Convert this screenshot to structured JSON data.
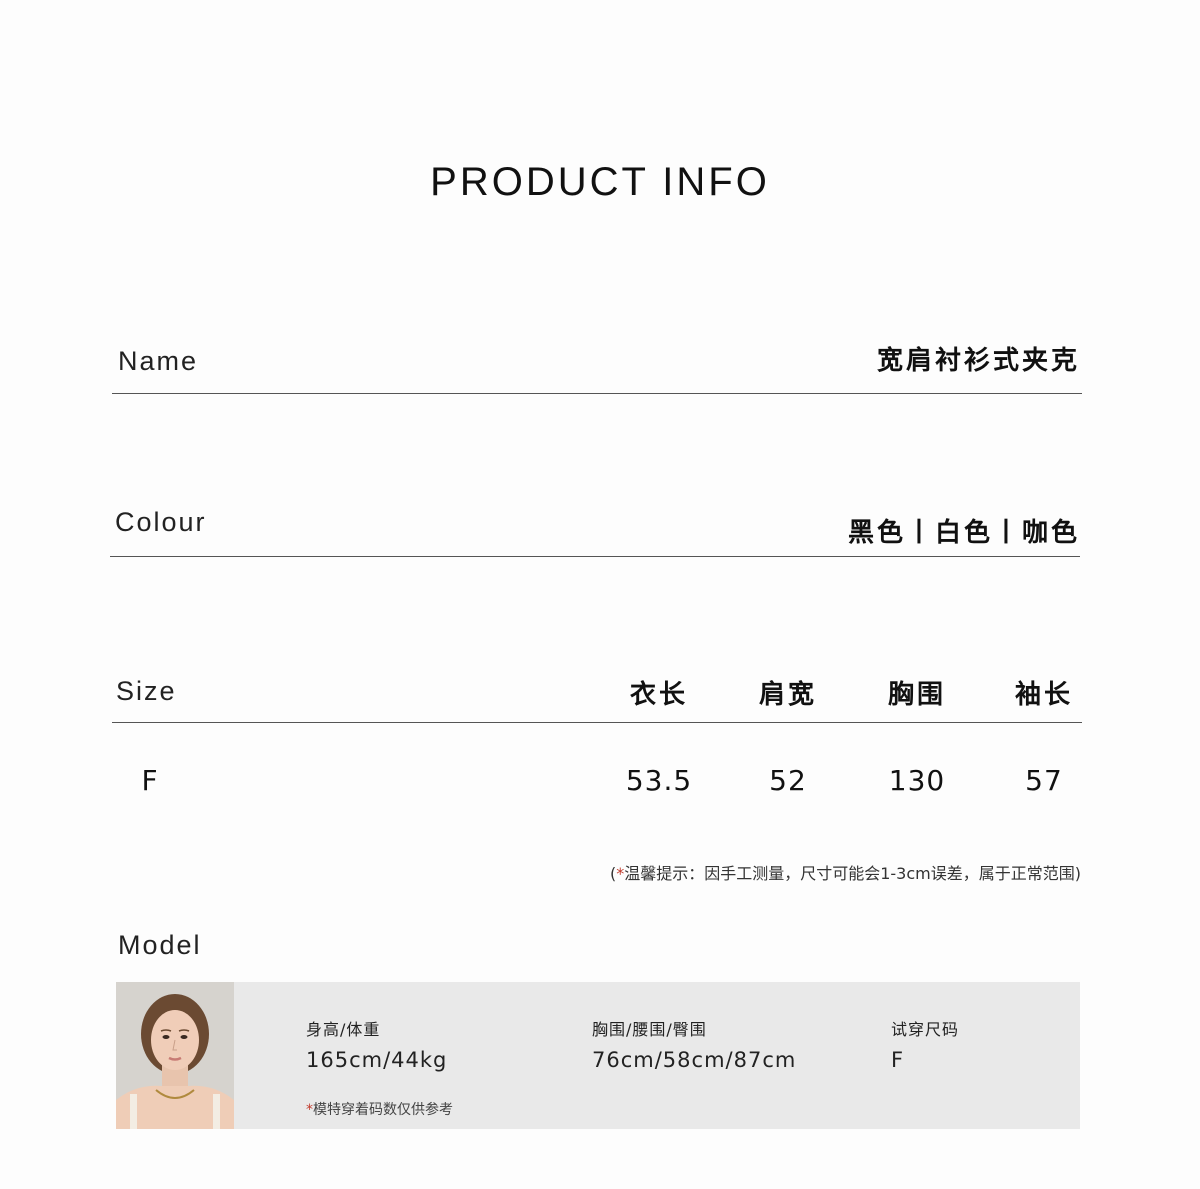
{
  "title": "PRODUCT INFO",
  "name": {
    "label": "Name",
    "value": "宽肩衬衫式夹克"
  },
  "colour": {
    "label": "Colour",
    "value": "黑色丨白色丨咖色"
  },
  "size": {
    "label": "Size",
    "columns": [
      "衣长",
      "肩宽",
      "胸围",
      "袖长"
    ],
    "rows": [
      {
        "size": "F",
        "values": [
          "53.5",
          "52",
          "130",
          "57"
        ]
      }
    ]
  },
  "note": {
    "star": "*",
    "text": "温馨提示：因手工测量，尺寸可能会1-3cm误差，属于正常范围",
    "open": "(",
    "close": ")"
  },
  "model": {
    "label": "Model",
    "height_weight_label": "身高/体重",
    "height_weight_value": "165cm/44kg",
    "measurements_label": "胸围/腰围/臀围",
    "measurements_value": "76cm/58cm/87cm",
    "tried_size_label": "试穿尺码",
    "tried_size_value": "F",
    "note_star": "*",
    "note_text": "模特穿着码数仅供参考"
  },
  "colors": {
    "background": "#fdfdfd",
    "panel": "#e9e9e9",
    "rule": "#555555",
    "star": "#c0392b"
  }
}
